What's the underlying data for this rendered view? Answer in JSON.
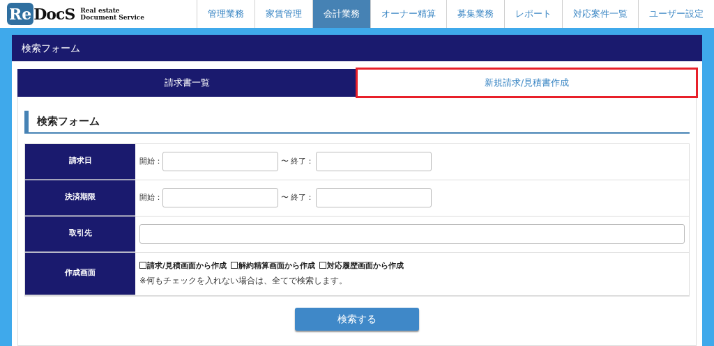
{
  "logo": {
    "mark": "Re",
    "name": "DocS",
    "tagline": [
      "Real estate",
      "Document Service"
    ]
  },
  "nav": [
    {
      "label": "管理業務",
      "selected": false
    },
    {
      "label": "家賃管理",
      "selected": false
    },
    {
      "label": "会計業務",
      "selected": true
    },
    {
      "label": "オーナー精算",
      "selected": false
    },
    {
      "label": "募集業務",
      "selected": false
    },
    {
      "label": "レポート",
      "selected": false
    },
    {
      "label": "対応案件一覧",
      "selected": false
    },
    {
      "label": "ユーザー設定",
      "selected": false
    }
  ],
  "panel": {
    "title": "検索フォーム"
  },
  "tabs": [
    {
      "label": "請求書一覧",
      "selected": true,
      "highlighted": false
    },
    {
      "label": "新規請求/見積書作成",
      "selected": false,
      "highlighted": true
    }
  ],
  "section": {
    "title": "検索フォーム"
  },
  "form": {
    "rows": [
      {
        "kind": "range",
        "label": "請求日",
        "start_label": "開始：",
        "end_label": "〜 終了："
      },
      {
        "kind": "range",
        "label": "決済期限",
        "start_label": "開始：",
        "end_label": "〜 終了："
      },
      {
        "kind": "text",
        "label": "取引先"
      },
      {
        "kind": "checks",
        "label": "作成画面",
        "options": [
          {
            "label": "請求/見積画面から作成",
            "checked": false
          },
          {
            "label": "解約精算画面から作成",
            "checked": false
          },
          {
            "label": "対応履歴画面から作成",
            "checked": false
          }
        ],
        "note": "※何もチェックを入れない場合は、全てで検索します。"
      }
    ]
  },
  "search_button": "検索する"
}
